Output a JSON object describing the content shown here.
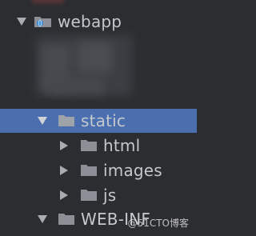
{
  "tree": {
    "webapp": {
      "label": "webapp",
      "expanded": true,
      "icon": "web-module-folder-icon"
    },
    "static": {
      "label": "static",
      "expanded": true,
      "selected": true,
      "icon": "folder-icon"
    },
    "children": [
      {
        "label": "html",
        "expanded": false,
        "icon": "folder-icon"
      },
      {
        "label": "images",
        "expanded": false,
        "icon": "folder-icon"
      },
      {
        "label": "js",
        "expanded": false,
        "icon": "folder-icon"
      }
    ],
    "webinf": {
      "label": "WEB-INF",
      "expanded": true,
      "icon": "folder-icon"
    }
  },
  "watermark": {
    "text": "@51CTO博客"
  },
  "colors": {
    "background": "#2b2d30",
    "selection": "#4b6eaf",
    "text": "#c5c8cc",
    "folder": "#8c9096",
    "arrow": "#a9acb0"
  }
}
